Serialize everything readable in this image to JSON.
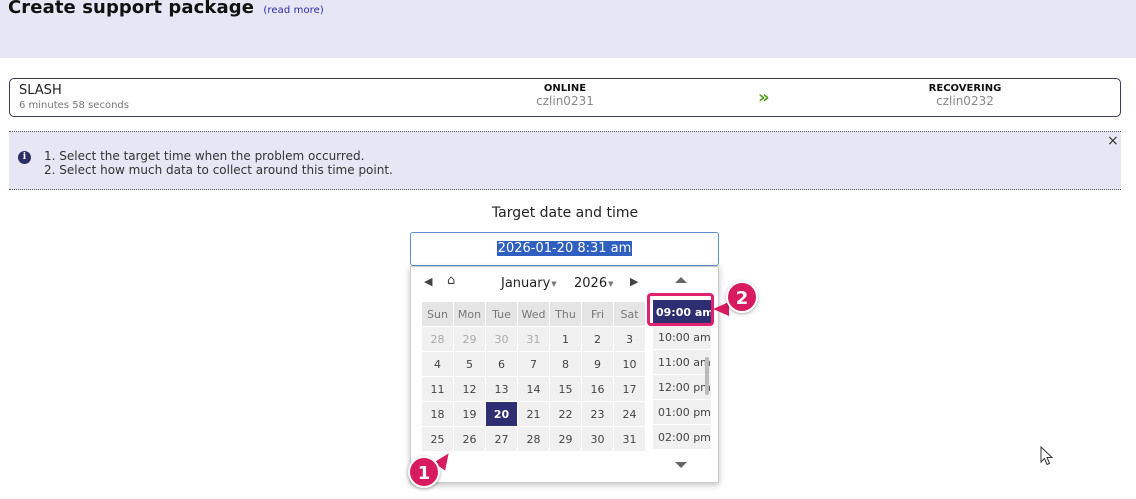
{
  "header": {
    "title": "Create support package",
    "read_more": "(read more)"
  },
  "status": {
    "system_name": "SLASH",
    "uptime": "6 minutes 58 seconds",
    "left_node": {
      "state": "ONLINE",
      "host": "czlin0231"
    },
    "right_node": {
      "state": "RECOVERING",
      "host": "czlin0232"
    },
    "arrow": "»"
  },
  "info": {
    "line1": "1. Select the target time when the problem occurred.",
    "line2": "2. Select how much data to collect around this time point.",
    "close": "×"
  },
  "target": {
    "label": "Target date and time",
    "value": "2026-01-20 8:31 am"
  },
  "calendar": {
    "month": "January",
    "year": "2026",
    "weekdays": [
      "Sun",
      "Mon",
      "Tue",
      "Wed",
      "Thu",
      "Fri",
      "Sat"
    ],
    "weeks": [
      [
        "28",
        "29",
        "30",
        "31",
        "1",
        "2",
        "3"
      ],
      [
        "4",
        "5",
        "6",
        "7",
        "8",
        "9",
        "10"
      ],
      [
        "11",
        "12",
        "13",
        "14",
        "15",
        "16",
        "17"
      ],
      [
        "18",
        "19",
        "20",
        "21",
        "22",
        "23",
        "24"
      ],
      [
        "25",
        "26",
        "27",
        "28",
        "29",
        "30",
        "31"
      ]
    ],
    "selected_day": "20"
  },
  "times": {
    "items": [
      "09:00 am",
      "10:00 am",
      "11:00 am",
      "12:00 pm",
      "01:00 pm",
      "02:00 pm"
    ],
    "selected": "09:00 am"
  },
  "annotations": {
    "badge1": "1",
    "badge2": "2",
    "accent": "#d81b60"
  },
  "colors": {
    "header_band": "#e6e6f5",
    "selected": "#2e2e72",
    "arrow": "#58a020"
  }
}
